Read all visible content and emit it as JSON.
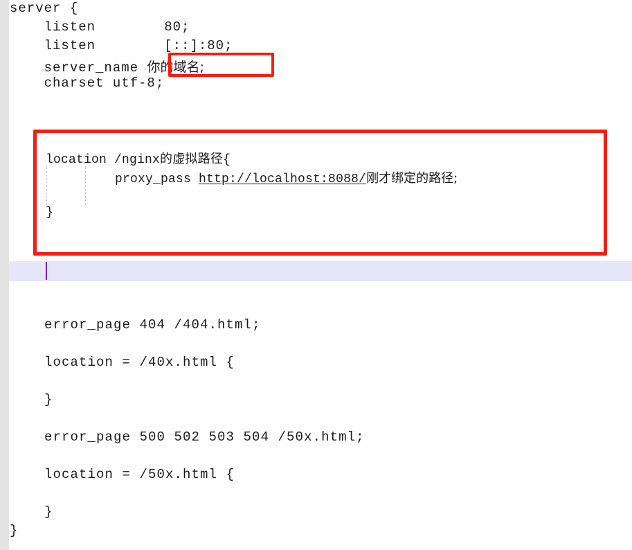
{
  "editor": {
    "kind": "nginx-config-editor",
    "background_color": "#ffffff",
    "text_color": "#1a1a1a",
    "gutter_color": "#e3e3e1",
    "highlight_color": "#e6e6fa",
    "caret_color": "#7a00d4",
    "annotation_color": "#f81c12"
  },
  "code": {
    "line1": "server {",
    "line2": "    listen        80;",
    "line3": "    listen        [::]:80;",
    "line4_label": "    server_name ",
    "line4_boxed": "你的域名;",
    "line5": "    charset utf-8;",
    "block_line1": "location /nginx的虚拟路径{",
    "block_line2_prefix": "    proxy_pass ",
    "block_line2_url": "http://localhost:8088/",
    "block_line2_suffix": "刚才绑定的路径;",
    "block_line3": "}",
    "line_error_404": "    error_page 404 /404.html;",
    "line_location_40x": "    location = /40x.html {",
    "line_close_40x": "    }",
    "line_error_50x": "    error_page 500 502 503 504 /50x.html;",
    "line_location_50x": "    location = /50x.html {",
    "line_close_50x": "    }",
    "line_close_server": "}"
  },
  "annotations": {
    "box_domain_name": "highlight-server-name-value",
    "box_location_block": "highlight-location-proxy-block"
  }
}
